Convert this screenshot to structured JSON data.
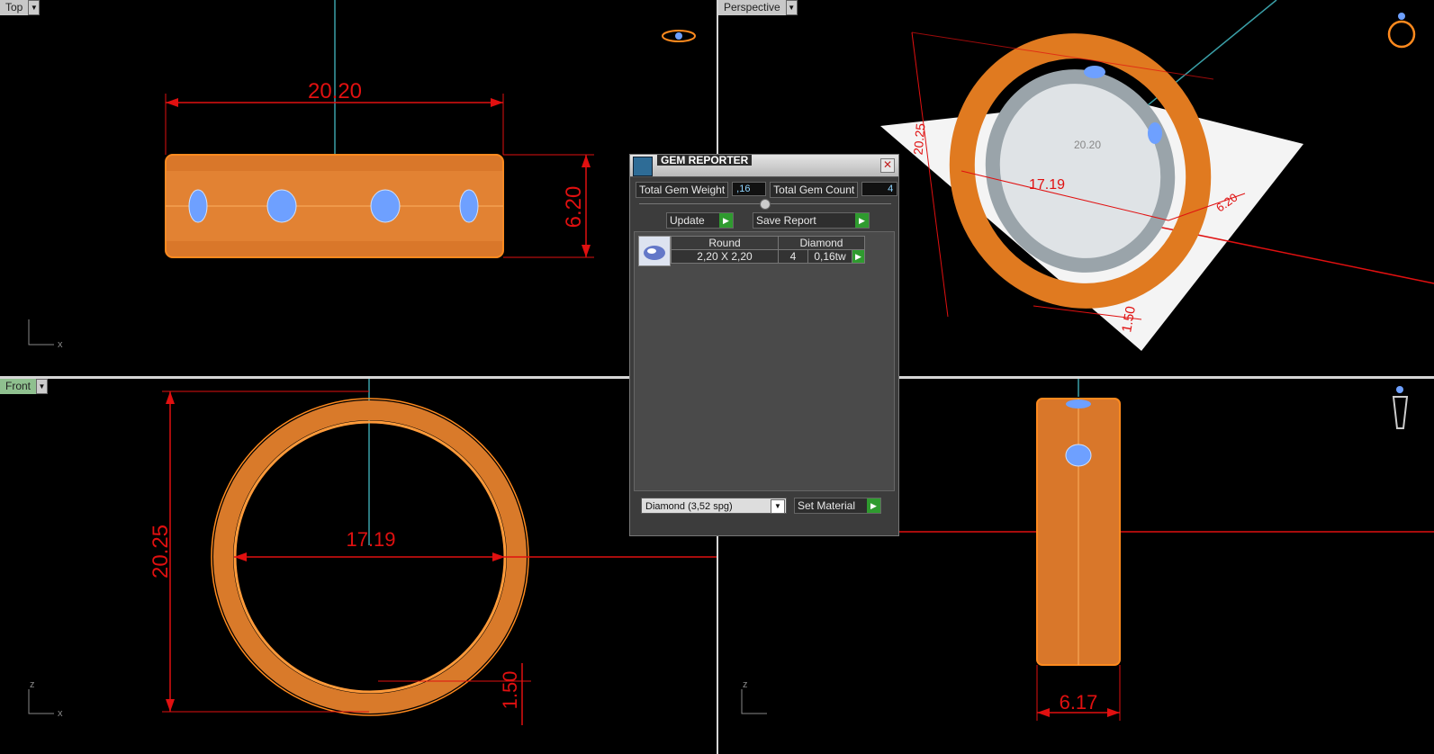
{
  "viewports": {
    "top": {
      "label": "Top",
      "dim_width": "20.20",
      "dim_height": "6.20",
      "axis_x": "x"
    },
    "perspective": {
      "label": "Perspective",
      "dim_outer": "20.25",
      "dim_inner": "17.19",
      "dim_top": "20.20",
      "dim_width": "6.20",
      "dim_thick": "1.50"
    },
    "front": {
      "label": "Front",
      "dim_outer": "20.25",
      "dim_inner": "17.19",
      "dim_thick": "1.50",
      "axis_x": "x",
      "axis_z": "z"
    },
    "side": {
      "dim_width": "6.17",
      "axis_z": "z"
    }
  },
  "gem_reporter": {
    "title": "GEM REPORTER",
    "close_label": "✕",
    "total_weight_label": "Total Gem Weight",
    "total_weight_value": ",16",
    "total_count_label": "Total Gem Count",
    "total_count_value": "4",
    "update_label": "Update",
    "save_report_label": "Save Report",
    "table": {
      "headers": [
        "Round",
        "Diamond"
      ],
      "row": {
        "size": "2,20 X 2,20",
        "count": "4",
        "weight": "0,16tw"
      }
    },
    "material_select": "Diamond    (3,52 spg)",
    "set_material_label": "Set Material"
  },
  "colors": {
    "ring": "#ff8a1e",
    "dimension": "#e01010",
    "gem": "#6ea0ff",
    "axis": "#3aa0a8"
  }
}
